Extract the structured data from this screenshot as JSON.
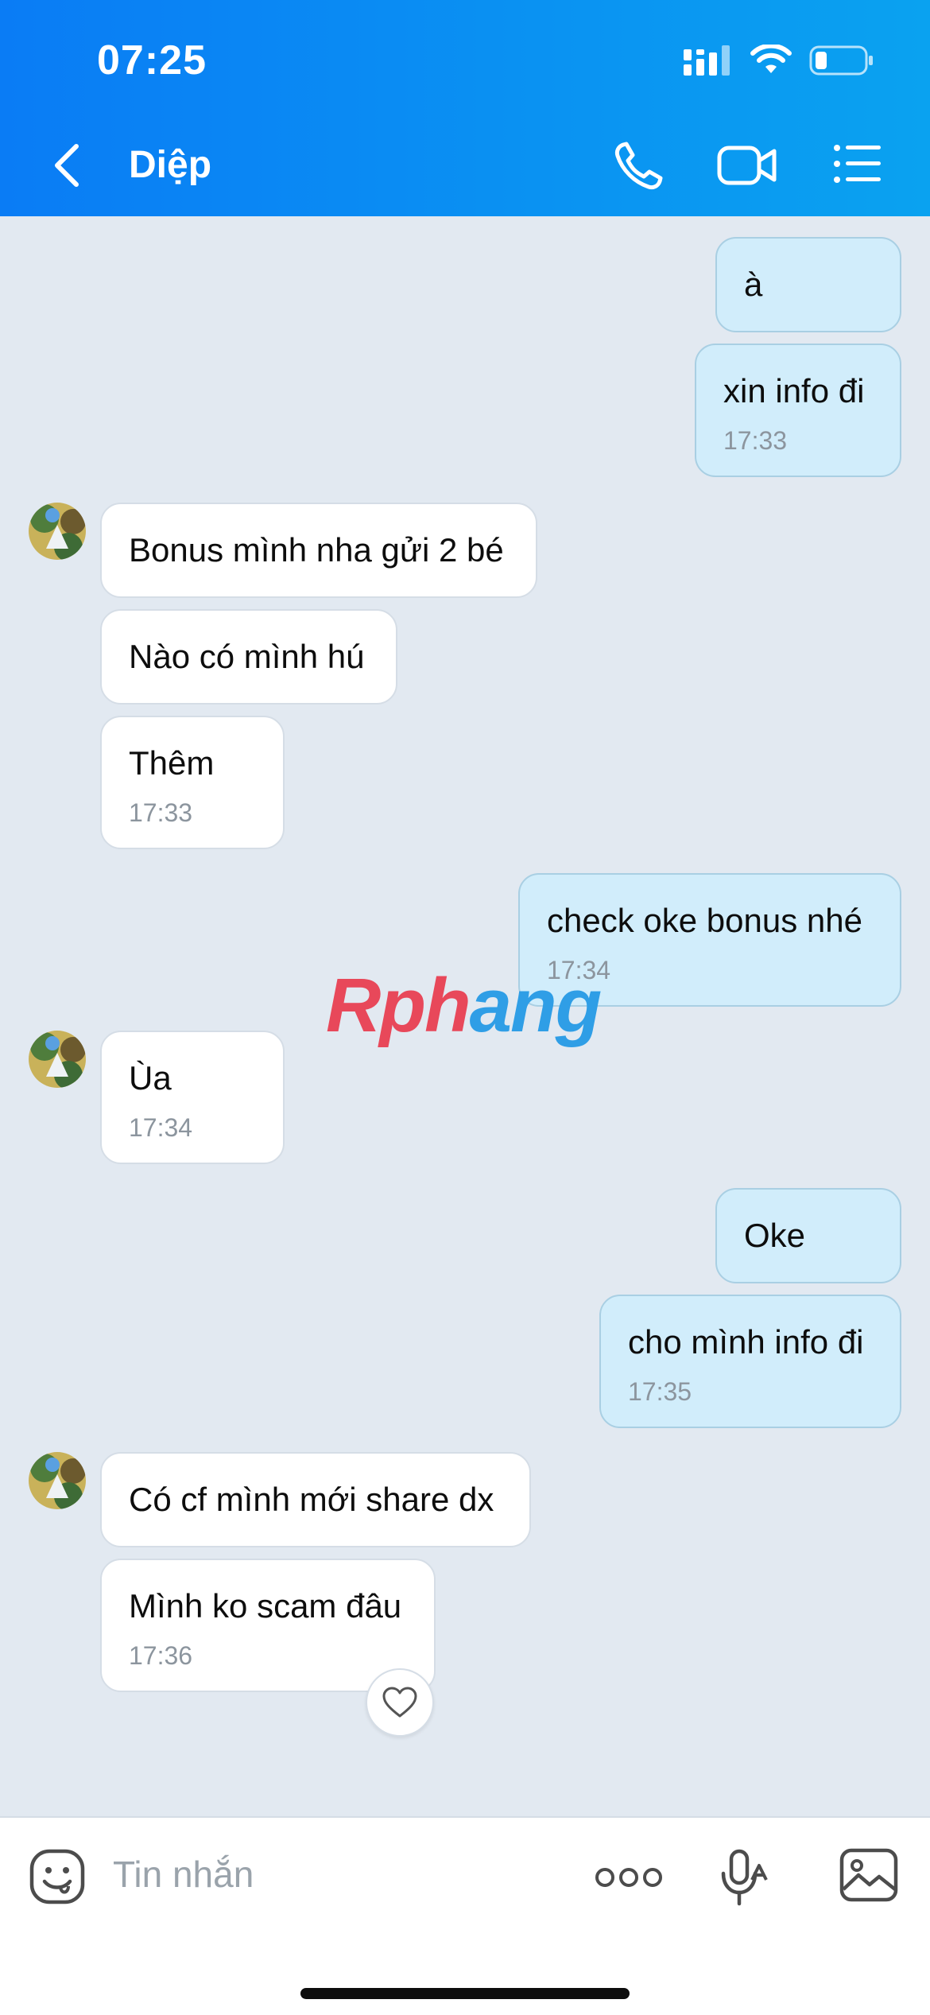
{
  "status_bar": {
    "time": "07:25"
  },
  "header": {
    "contact_name": "Diệp"
  },
  "messages": [
    {
      "dir": "out",
      "text": "à",
      "time": ""
    },
    {
      "dir": "out",
      "text": "xin info đi",
      "time": "17:33"
    },
    {
      "dir": "in",
      "text": "Bonus mình nha gửi 2 bé",
      "time": ""
    },
    {
      "dir": "in",
      "text": "Nào có mình hú",
      "time": ""
    },
    {
      "dir": "in",
      "text": "Thêm",
      "time": "17:33"
    },
    {
      "dir": "out",
      "text": "check oke bonus nhé",
      "time": "17:34"
    },
    {
      "dir": "in",
      "text": "Ùa",
      "time": "17:34"
    },
    {
      "dir": "out",
      "text": "Oke",
      "time": ""
    },
    {
      "dir": "out",
      "text": "cho mình info đi",
      "time": "17:35"
    },
    {
      "dir": "in",
      "text": "Có cf mình mới share dx",
      "time": ""
    },
    {
      "dir": "in",
      "text": "Mình ko scam đâu",
      "time": "17:36"
    }
  ],
  "watermark": {
    "part1": "Rph",
    "part2": "ang"
  },
  "composer": {
    "placeholder": "Tin nhắn"
  },
  "icons": {
    "back": "chevron-left-icon",
    "call": "phone-icon",
    "video": "video-camera-icon",
    "menu": "list-menu-icon",
    "emoji": "sticker-face-icon",
    "more": "more-dots-icon",
    "voice": "microphone-icon",
    "image": "image-gallery-icon",
    "reaction": "heart-icon"
  },
  "colors": {
    "header_start": "#0a7cf5",
    "header_end": "#0aa2f0",
    "outgoing_bubble": "#d1edfb",
    "incoming_bubble": "#ffffff",
    "chat_background": "#e2e9f1"
  }
}
